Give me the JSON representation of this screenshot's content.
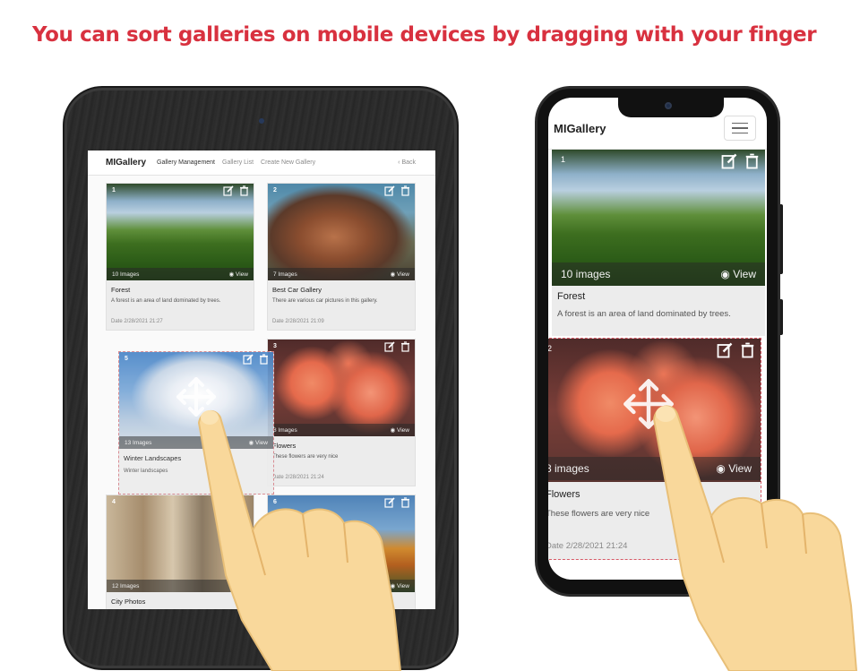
{
  "headline": "You can sort galleries on mobile devices by dragging with your finger",
  "tablet": {
    "nav": {
      "brand": "MIGallery",
      "links": [
        "Gallery Management",
        "Gallery List",
        "Create New Gallery"
      ],
      "back": "Back"
    },
    "cards": [
      {
        "num": "1",
        "images": "10 Images",
        "view": "View",
        "title": "Forest",
        "desc": "A forest is an area of land dominated by trees.",
        "date": "Date   2/28/2021 21:27"
      },
      {
        "num": "2",
        "images": "7 Images",
        "view": "View",
        "title": "Best Car Gallery",
        "desc": "There are various car pictures in this gallery.",
        "date": "Date   2/28/2021 21:09"
      },
      {
        "num": "3",
        "images": "8 Images",
        "view": "View",
        "title": "Flowers",
        "desc": "These flowers are very nice",
        "date": "Date   2/28/2021 21:24"
      },
      {
        "num": "5",
        "images": "13 Images",
        "view": "View",
        "title": "Winter Landscapes",
        "desc": "Winter landscapes",
        "date": ""
      },
      {
        "num": "4",
        "images": "12 Images",
        "view": "",
        "title": "City Photos",
        "desc": "",
        "date": ""
      },
      {
        "num": "6",
        "images": "",
        "view": "View",
        "title": "",
        "desc": "",
        "date": ""
      }
    ]
  },
  "phone": {
    "nav": {
      "brand": "MIGallery"
    },
    "cards": [
      {
        "num": "1",
        "images": "10 images",
        "view": "View",
        "title": "Forest",
        "desc": "A forest is an area of land dominated by trees.",
        "date": ""
      },
      {
        "num": "2",
        "images": "8 images",
        "view": "View",
        "title": "Flowers",
        "desc": "These flowers are very nice",
        "date": "Date   2/28/2021 21:24"
      }
    ]
  },
  "icons": {
    "edit": "edit-icon",
    "delete": "trash-icon",
    "view": "eye-icon",
    "back": "chevron-left-icon",
    "drag": "move-arrows-icon",
    "menu": "hamburger-menu-icon"
  },
  "colors": {
    "headline": "#d8313f",
    "tablet_frame": "#2a2a2a",
    "phone_frame": "#111111",
    "drag_outline": "#d7848c",
    "hand_skin": "#f9d89b"
  }
}
